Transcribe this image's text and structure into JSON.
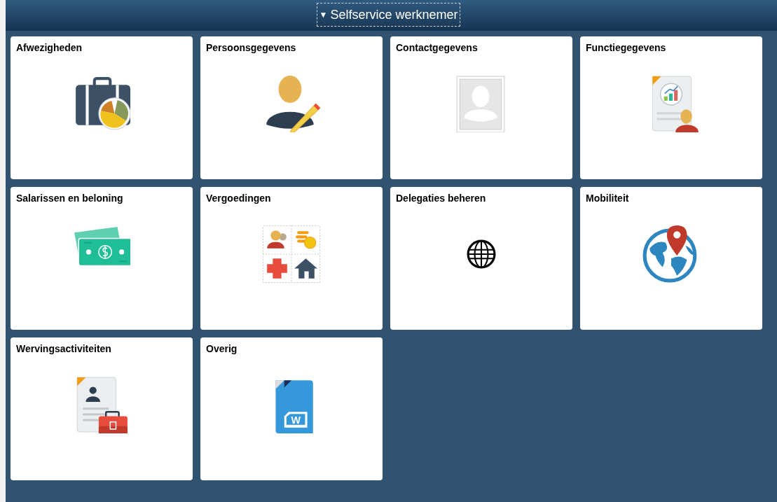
{
  "header": {
    "toggle": "▼",
    "title": "Selfservice werknemer"
  },
  "tiles": [
    {
      "title": "Afwezigheden",
      "kind": "briefcase-chart"
    },
    {
      "title": "Persoonsgegevens",
      "kind": "person-pencil"
    },
    {
      "title": "Contactgegevens",
      "kind": "photo-placeholder"
    },
    {
      "title": "Functiegegevens",
      "kind": "document-chart"
    },
    {
      "title": "Salarissen en beloning",
      "kind": "banknotes"
    },
    {
      "title": "Vergoedingen",
      "kind": "benefits-grid"
    },
    {
      "title": "Delegaties beheren",
      "kind": "globe"
    },
    {
      "title": "Mobiliteit",
      "kind": "globe-pin"
    },
    {
      "title": "Wervingsactiviteiten",
      "kind": "resume-briefcase"
    },
    {
      "title": "Overig",
      "kind": "word-document",
      "badge_letter": "W"
    }
  ]
}
